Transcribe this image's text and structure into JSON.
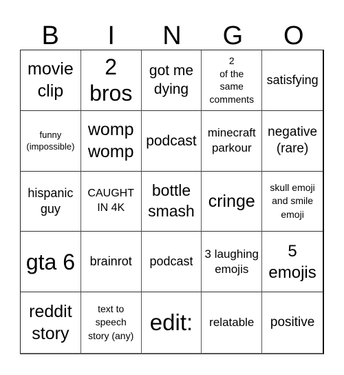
{
  "header": {
    "letters": [
      "B",
      "I",
      "N",
      "G",
      "O"
    ]
  },
  "cells": [
    [
      "movie clip",
      "2 bros",
      "got me dying",
      "2\nof the\nsame\ncomments",
      "satisfying"
    ],
    [
      "funny (impossible)",
      "womp womp",
      "podcast",
      "minecraft parkour",
      "negative (rare)"
    ],
    [
      "hispanic guy",
      "CAUGHT IN 4K",
      "bottle smash",
      "cringe",
      "skull emoji and smile emoji"
    ],
    [
      "gta 6",
      "brainrot",
      "podcast",
      "3 laughing emojis",
      "5 emojis"
    ],
    [
      "reddit story",
      "text to speech story (any)",
      "edit:",
      "relatable",
      "positive"
    ]
  ]
}
